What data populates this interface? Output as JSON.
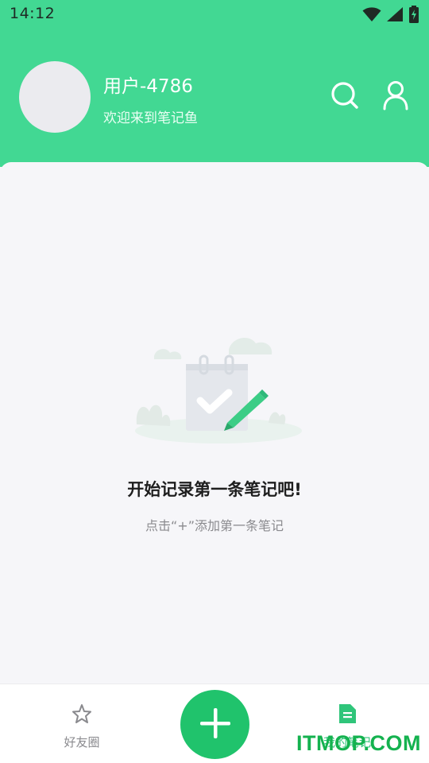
{
  "status_bar": {
    "time": "14:12",
    "icons": [
      "wifi-icon",
      "signal-icon",
      "battery-icon"
    ]
  },
  "header": {
    "username": "用户-4786",
    "welcome": "欢迎来到笔记鱼",
    "actions": [
      "search-icon",
      "user-icon"
    ]
  },
  "empty_state": {
    "title": "开始记录第一条笔记吧!",
    "subtitle": "点击“+”添加第一条笔记"
  },
  "bottom_nav": {
    "items": [
      {
        "label": "好友圈",
        "icon": "star-icon",
        "active": false
      },
      {
        "label": "我的笔记",
        "icon": "document-icon",
        "active": true
      }
    ],
    "fab_icon": "plus-icon"
  },
  "watermark": "ITMOP.COM",
  "colors": {
    "header_green": "#42d893",
    "fab_green": "#20c36c",
    "active_green": "#2fc57a",
    "background": "#f6f6f9"
  }
}
